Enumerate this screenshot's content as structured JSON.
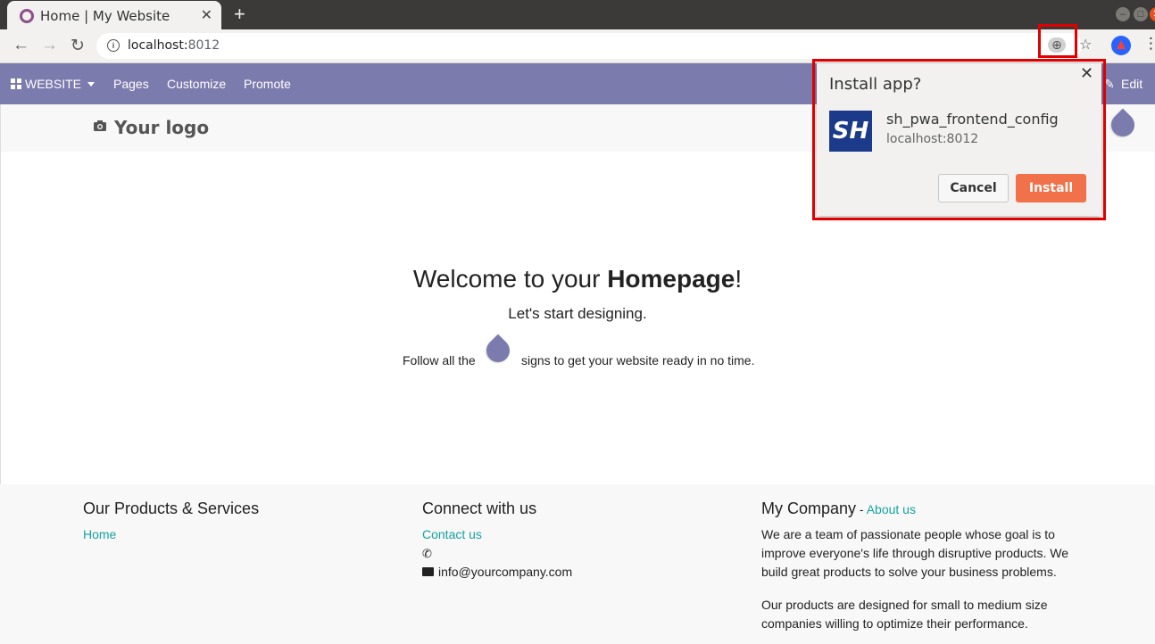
{
  "browser": {
    "tab_title": "Home | My Website",
    "url_host": "localhost:",
    "url_port": "8012"
  },
  "odoo_nav": {
    "website_label": "WEBSITE",
    "items": [
      "Pages",
      "Customize",
      "Promote"
    ],
    "edit_label": "Edit"
  },
  "header": {
    "logo_text": "Your logo"
  },
  "main": {
    "welcome_prefix": "Welcome to your ",
    "welcome_bold": "Homepage",
    "welcome_suffix": "!",
    "subtitle": "Let's start designing.",
    "follow_before": "Follow all the",
    "follow_after": "signs to get your website ready in no time."
  },
  "footer": {
    "products": {
      "heading": "Our Products & Services",
      "links": [
        "Home"
      ]
    },
    "connect": {
      "heading": "Connect with us",
      "contact_link": "Contact us",
      "email": "info@yourcompany.com"
    },
    "company": {
      "heading": "My Company",
      "separator": " - ",
      "about_link": "About us",
      "para1": "We are a team of passionate people whose goal is to improve everyone's life through disruptive products. We build great products to solve your business problems.",
      "para2": "Our products are designed for small to medium size companies willing to optimize their performance."
    }
  },
  "install_dialog": {
    "title": "Install app?",
    "app_name": "sh_pwa_frontend_config",
    "app_origin": "localhost:8012",
    "cancel_label": "Cancel",
    "install_label": "Install"
  },
  "colors": {
    "odoo_purple": "#7c7bad",
    "link_teal": "#17a2a0",
    "install_orange": "#f0714a",
    "highlight_red": "#e00000"
  }
}
